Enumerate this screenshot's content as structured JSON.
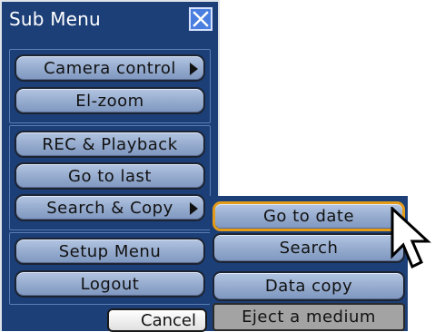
{
  "window": {
    "title": "Sub Menu"
  },
  "menu": {
    "camera_control": "Camera control",
    "el_zoom": "El-zoom",
    "rec_playback": "REC & Playback",
    "go_to_last": "Go to last",
    "search_copy": "Search & Copy",
    "setup_menu": "Setup Menu",
    "logout": "Logout",
    "cancel": "Cancel"
  },
  "submenu": {
    "go_to_date": "Go to date",
    "search": "Search",
    "data_copy": "Data copy",
    "eject_medium": "Eject a medium"
  },
  "icons": {
    "close": "close-icon",
    "submenu_arrow": "triangle-right-icon",
    "cursor": "mouse-pointer-icon"
  },
  "colors": {
    "panel_bg": "#1c3f78",
    "button_bg": "#94aacd",
    "selected_border": "#e39b1a",
    "disabled_bg": "#a3a3a3",
    "close_bg": "#4a7fe0"
  }
}
